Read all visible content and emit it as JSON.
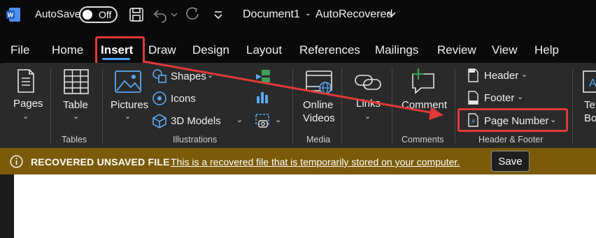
{
  "titlebar": {
    "autosave_label": "AutoSave",
    "toggle_state": "Off",
    "document_title": "Document1  -  AutoRecovered",
    "icons": [
      "word-logo-icon",
      "save-icon",
      "undo-icon",
      "redo-icon",
      "customize-icon"
    ]
  },
  "menu": {
    "tabs": [
      {
        "label": "File"
      },
      {
        "label": "Home"
      },
      {
        "label": "Insert",
        "active": true
      },
      {
        "label": "Draw"
      },
      {
        "label": "Design"
      },
      {
        "label": "Layout"
      },
      {
        "label": "References"
      },
      {
        "label": "Mailings"
      },
      {
        "label": "Review"
      },
      {
        "label": "View"
      },
      {
        "label": "Help"
      }
    ]
  },
  "ribbon": {
    "pages": {
      "label": "Pages"
    },
    "tables": {
      "table_label": "Table",
      "group": "Tables"
    },
    "illustrations": {
      "pictures": "Pictures",
      "shapes": "Shapes",
      "icons": "Icons",
      "models": "3D Models",
      "group": "Illustrations"
    },
    "media": {
      "line1": "Online",
      "line2": "Videos",
      "group": "Media"
    },
    "links": {
      "label": "Links"
    },
    "comments": {
      "label": "Comment",
      "group": "Comments"
    },
    "header_footer": {
      "header": "Header",
      "footer": "Footer",
      "page_number": "Page Number",
      "group": "Header & Footer"
    },
    "text": {
      "line1": "Te",
      "line2": "Bo"
    }
  },
  "infobar": {
    "title": "RECOVERED UNSAVED FILE",
    "message": "This is a recovered file that is temporarily stored on your computer.",
    "save_label": "Save"
  },
  "colors": {
    "accent_blue": "#4a9cf0",
    "annotation_red": "#e03a3a",
    "infobar_bg": "#7b5b0a"
  }
}
